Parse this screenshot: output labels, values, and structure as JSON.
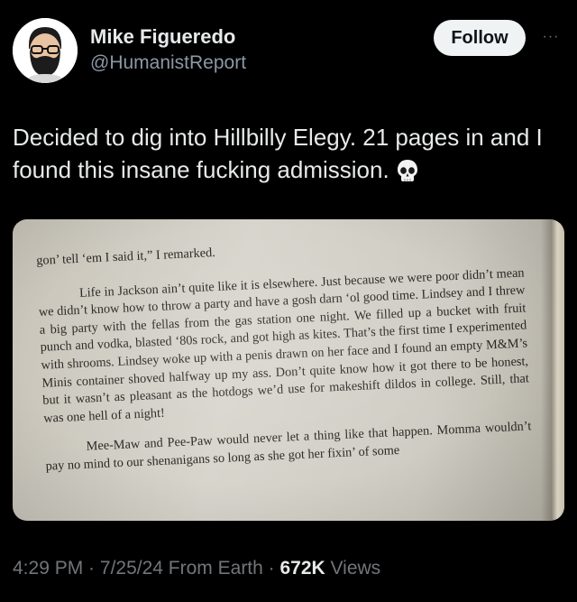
{
  "author": {
    "display_name": "Mike Figueredo",
    "handle": "@HumanistReport",
    "avatar_icon": "bearded-man-glasses-avatar"
  },
  "actions": {
    "follow_label": "Follow",
    "more_label": "···"
  },
  "tweet": {
    "text": "Decided to dig into Hillbilly Elegy. 21 pages in and I found this insane fucking admission.",
    "emoji_icon": "skull-icon"
  },
  "book_page": {
    "line_1": "gon’ tell ‘em I said it,” I remarked.",
    "paragraph_1": "Life in Jackson ain’t quite like it is elsewhere. Just because we were poor didn’t mean we didn’t know how to throw a party and have a gosh darn ‘ol good time. Lindsey and I threw a big party with the fellas from the gas station one night. We filled up a bucket with fruit punch and vodka, blasted ‘80s rock, and got high as kites. That’s the first time I experimented with shrooms. Lindsey woke up with a penis drawn on her face and I found an empty M&M’s Minis container shoved halfway up my ass. Don’t quite know how it got there to be honest, but it wasn’t as pleasant as the hotdogs we’d use for makeshift dildos in college. Still, that was one hell of a night!",
    "paragraph_2": "Mee-Maw and Pee-Paw would never let a thing like that happen. Momma wouldn’t pay no mind to our shenanigans so long as she got her fixin’ of some"
  },
  "meta": {
    "time": "4:29 PM",
    "sep1": " · ",
    "date": "7/25/24",
    "source": " From Earth",
    "sep2": " · ",
    "views_count": "672K",
    "views_label": " Views"
  }
}
